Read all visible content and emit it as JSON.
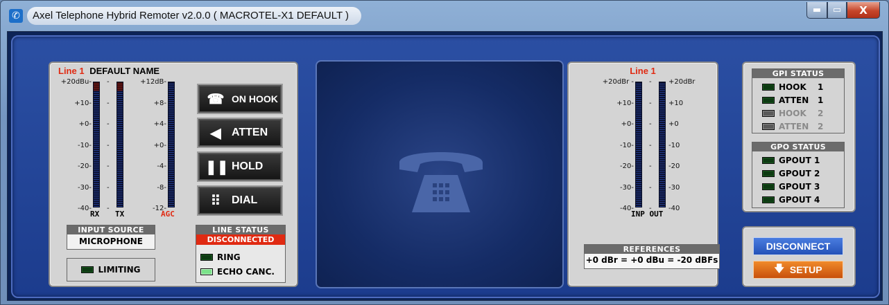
{
  "window": {
    "title": "Axel Telephone Hybrid Remoter v2.0.0 ( MACROTEL-X1 DEFAULT )",
    "icon": "phone-icon",
    "minimize_label": "▬",
    "maximize_label": "▭",
    "close_label": "X"
  },
  "line_panel": {
    "line_label": "Line 1",
    "name": "DEFAULT NAME",
    "rx_tx_scale": [
      "+20dBu-",
      "+10-",
      "+0-",
      "-10-",
      "-20-",
      "-30-",
      "-40-"
    ],
    "agc_scale": [
      "+12dB-",
      "+8-",
      "+4-",
      "+0-",
      "-4-",
      "-8-",
      "-12-"
    ],
    "rx_label": "RX",
    "tx_label": "TX",
    "agc_label": "AGC",
    "buttons": [
      {
        "label": "ON HOOK",
        "icon": "telephone-icon"
      },
      {
        "label": "ATTEN",
        "icon": "speaker-icon"
      },
      {
        "label": "HOLD",
        "icon": "pause-icon"
      },
      {
        "label": "DIAL",
        "icon": "keypad-icon"
      }
    ],
    "input_source": {
      "header": "INPUT SOURCE",
      "value": "MICROPHONE"
    },
    "limiting_label": "LIMITING",
    "line_status": {
      "header": "LINE STATUS",
      "value": "DISCONNECTED",
      "ring_label": "RING",
      "echo_label": "ECHO CANC."
    }
  },
  "io_panel": {
    "line_label": "Line 1",
    "left_scale": [
      "+20dBr -",
      "+10-",
      "+0-",
      "-10-",
      "-20-",
      "-30-",
      "-40-"
    ],
    "right_scale": [
      "+20dBr",
      "+10",
      "+0",
      "-10",
      "-20",
      "-30",
      "-40"
    ],
    "inp_out_label": "INP OUT",
    "references_header": "REFERENCES",
    "references_value": "+0 dBr = +0 dBu = -20 dBFs"
  },
  "gpi": {
    "header": "GPI STATUS",
    "items": [
      {
        "label": "HOOK",
        "num": "1",
        "enabled": true
      },
      {
        "label": "ATTEN",
        "num": "1",
        "enabled": true
      },
      {
        "label": "HOOK",
        "num": "2",
        "enabled": false
      },
      {
        "label": "ATTEN",
        "num": "2",
        "enabled": false
      }
    ]
  },
  "gpo": {
    "header": "GPO STATUS",
    "items": [
      {
        "label": "GPOUT 1"
      },
      {
        "label": "GPOUT 2"
      },
      {
        "label": "GPOUT 3"
      },
      {
        "label": "GPOUT 4"
      }
    ]
  },
  "controls": {
    "disconnect_label": "DISCONNECT",
    "setup_label": "SETUP",
    "setup_icon": "down-arrow-icon"
  },
  "colors": {
    "accent_red": "#e02a12",
    "disconnect_blue": "#2f5fc4",
    "setup_orange": "#e0650f"
  }
}
